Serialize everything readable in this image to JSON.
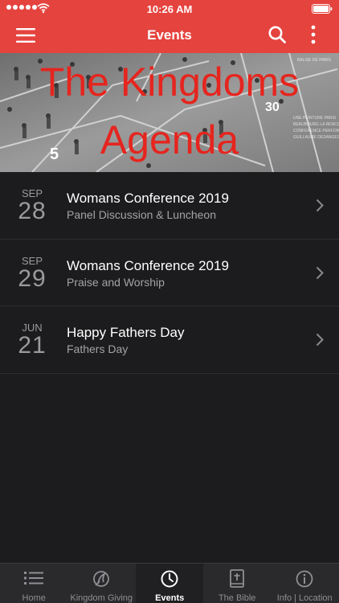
{
  "status_bar": {
    "time": "10:26 AM"
  },
  "nav": {
    "title": "Events"
  },
  "banner": {
    "line1": "The Kingdoms",
    "line2": "Agenda"
  },
  "events": [
    {
      "month": "SEP",
      "day": "28",
      "title": "Womans Conference 2019",
      "subtitle": "Panel Discussion & Luncheon"
    },
    {
      "month": "SEP",
      "day": "29",
      "title": "Womans Conference 2019",
      "subtitle": "Praise and Worship"
    },
    {
      "month": "JUN",
      "day": "21",
      "title": "Happy Fathers Day",
      "subtitle": "Fathers Day"
    }
  ],
  "tabs": [
    {
      "label": "Home",
      "icon": "list-icon"
    },
    {
      "label": "Kingdom Giving",
      "icon": "giving-icon"
    },
    {
      "label": "Events",
      "icon": "clock-icon",
      "active": true
    },
    {
      "label": "The Bible",
      "icon": "bible-icon"
    },
    {
      "label": "Info | Location",
      "icon": "info-icon"
    }
  ],
  "colors": {
    "brand": "#e5433e",
    "background": "#1c1c1e",
    "banner_text": "#e5251e"
  }
}
